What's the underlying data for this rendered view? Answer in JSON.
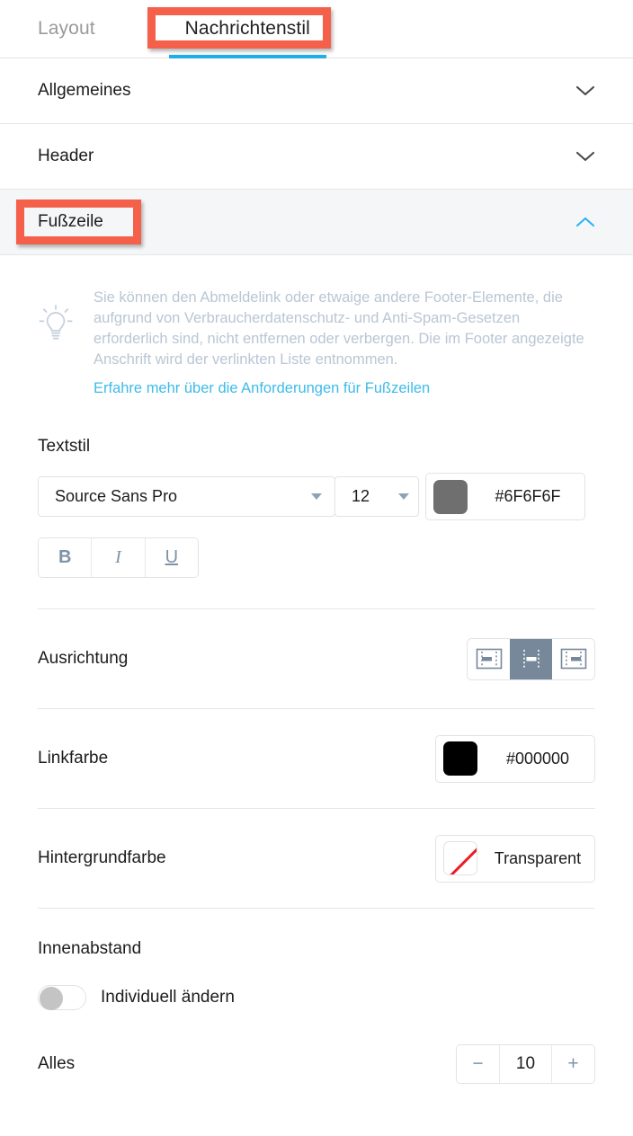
{
  "tabs": [
    {
      "label": "Layout",
      "active": false
    },
    {
      "label": "Nachrichtenstil",
      "active": true
    }
  ],
  "accordion": [
    {
      "label": "Allgemeines",
      "expanded": false,
      "icon": "chevron-down-icon"
    },
    {
      "label": "Header",
      "expanded": false,
      "icon": "chevron-down-icon"
    },
    {
      "label": "Fußzeile",
      "expanded": true,
      "icon": "chevron-up-icon"
    }
  ],
  "tip": {
    "icon": "lightbulb-icon",
    "text": "Sie können den Abmeldelink oder etwaige andere Footer-Elemente, die aufgrund von Verbraucherdatenschutz- und Anti-Spam-Gesetzen erforderlich sind, nicht entfernen oder verbergen. Die im Footer angezeigte Anschrift wird der verlinkten Liste entnommen.",
    "link": "Erfahre mehr über die Anforderungen für Fußzeilen"
  },
  "textstyle": {
    "title": "Textstil",
    "font_family": "Source Sans Pro",
    "font_size": "12",
    "color_hex": "#6F6F6F",
    "color_value": "#6F6F6F",
    "bold_label": "B",
    "italic_label": "I",
    "underline_label": "U"
  },
  "alignment": {
    "label": "Ausrichtung",
    "options": [
      "left",
      "center",
      "right"
    ],
    "selected": "center"
  },
  "link_color": {
    "label": "Linkfarbe",
    "hex": "#000000",
    "value": "#000000"
  },
  "background_color": {
    "label": "Hintergrundfarbe",
    "hex": "Transparent",
    "value": "transparent"
  },
  "padding": {
    "title": "Innenabstand",
    "toggle_label": "Individuell ändern",
    "toggle_on": false,
    "all_label": "Alles",
    "all_value": "10",
    "minus_label": "−",
    "plus_label": "+"
  },
  "annotations": {
    "color": "#F4604A",
    "boxes": [
      "Nachrichtenstil",
      "Fußzeile"
    ]
  },
  "colors": {
    "accent_tab_underline": "#22AEE4",
    "link": "#3DBBE8",
    "tip_text": "#B9C6D4",
    "expanded_row_bg": "#F4F6F8",
    "selected_align_bg": "#77889B"
  }
}
